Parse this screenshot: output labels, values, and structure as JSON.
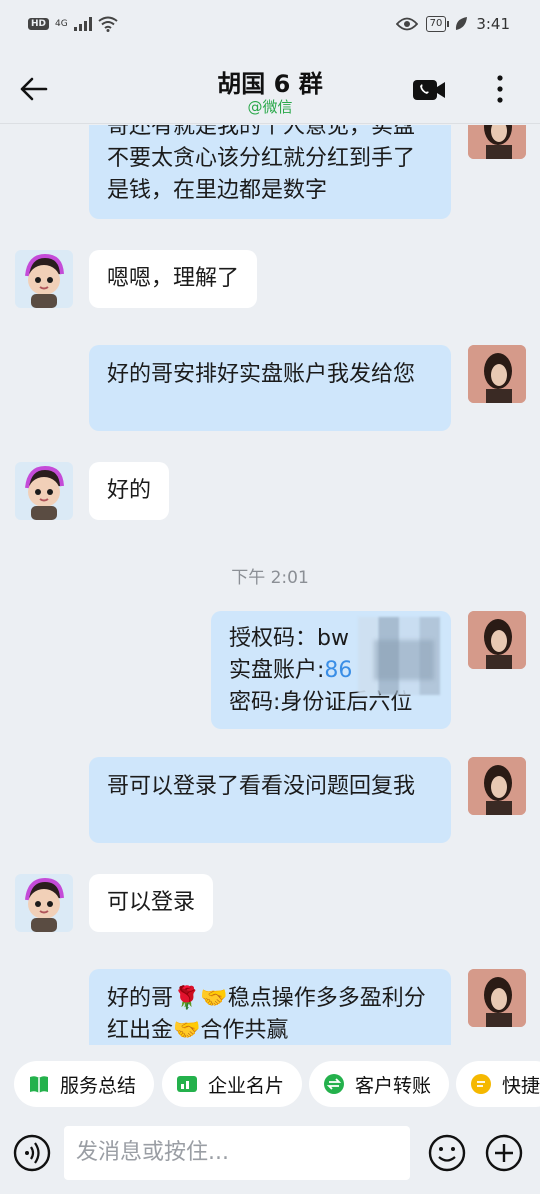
{
  "status_bar": {
    "hd": "HD",
    "network": "4G",
    "battery": "70",
    "time": "3:41"
  },
  "header": {
    "title": "胡国 6 群",
    "subtitle": "@微信"
  },
  "messages": [
    {
      "side": "me",
      "text": "哥还有就是我的个人意见，实盘不要太贪心该分红就分红到手了是钱，在里边都是数字"
    },
    {
      "side": "other",
      "text": "嗯嗯，理解了"
    },
    {
      "side": "me",
      "text": "好的哥安排好实盘账户我发给您"
    },
    {
      "side": "other",
      "text": "好的"
    },
    {
      "side": "me",
      "lines": [
        "授权码：bw",
        "实盘账户:",
        "86",
        "密码:身份证后六位"
      ]
    },
    {
      "side": "me",
      "text": "哥可以登录了看看没问题回复我"
    },
    {
      "side": "other",
      "text": "可以登录"
    },
    {
      "side": "me",
      "text": "好的哥🌹🤝稳点操作多多盈利分红出金🤝合作共赢"
    }
  ],
  "timestamp": "下午 2:01",
  "quick_actions": [
    "服务总结",
    "企业名片",
    "客户转账",
    "快捷"
  ],
  "input": {
    "placeholder": "发消息或按住..."
  },
  "colors": {
    "me_bubble": "#cfe6fb",
    "other_bubble": "#ffffff",
    "subtitle": "#2aa84a",
    "background": "#eceff3"
  }
}
